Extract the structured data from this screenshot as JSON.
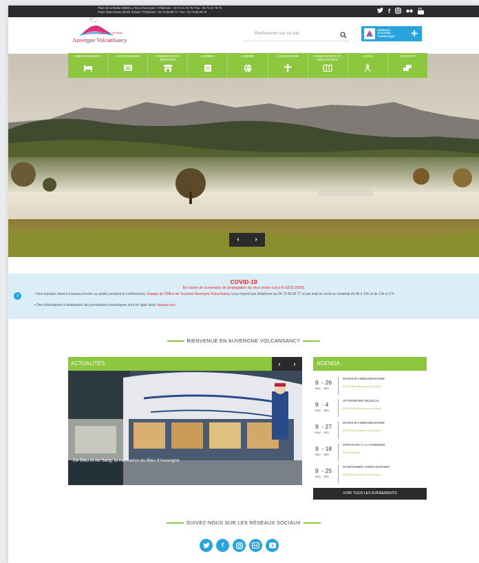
{
  "topbar": {
    "address_line1": "Place de la Mairie 63680 La Tour d'Auvergne / Téléphone : 04 73 21 79 78 / Fax : 04 73 21 79 70",
    "address_line2": "Place Notre-Dame 63210 Orcival / Téléphone : 04 73 65 89 77 / Fax : 04 73 65 89 78",
    "social_icons": [
      "twitter-icon",
      "facebook-icon",
      "instagram-icon",
      "flickr-icon",
      "youtube-icon"
    ]
  },
  "header": {
    "logo_text": "Auvergne VolcanSancy",
    "logo_sub": "Office de Tourisme",
    "search_placeholder": "Rechercher sur ce site",
    "bureau_label": "BUREAUX D'ACCUEIL TOURISTIQUE",
    "bureau_plus": "+"
  },
  "nav": [
    {
      "label": "HÉBERGEMENTS",
      "icon": "bed-icon"
    },
    {
      "label": "GASTRONOMIE",
      "icon": "cutlery-icon"
    },
    {
      "label": "COMMERCES ET SERVICES",
      "icon": "shop-icon"
    },
    {
      "label": "AGENDA",
      "icon": "calendar-icon"
    },
    {
      "label": "LOISIRS",
      "icon": "ball-icon"
    },
    {
      "label": "À DÉCOUVRIR",
      "icon": "cross-icon"
    },
    {
      "label": "RANDONNÉES ET BROCHURES",
      "icon": "map-icon"
    },
    {
      "label": "ACCÈS",
      "icon": "route-icon"
    },
    {
      "label": "CONTACT",
      "icon": "contact-icon"
    }
  ],
  "hero": {
    "prev": "‹",
    "next": "›"
  },
  "covid": {
    "title": "COVID-19",
    "subtitle": "En raison de la menace de propagation du virus (mise à jour le 02/11/2020)",
    "line1_a": "Nos bureaux étant à nouveau fermés au public pendant le confinement, ",
    "line1_link": "l'équipe de l'Office de Tourisme Auvergne VolcanSancy",
    "line1_b": " vous répond par téléphone au 04 73 65 89 77 et par mail du lundi au vendredi de 9h à 12h et de 13h à 17h.",
    "line2_a": "Des informations à destination des prestataires touristiques sont en ligne dans ",
    "line2_link": "l'espace pro."
  },
  "welcome": "BIENVENUE EN AUVERGNE VOLCANSANCY",
  "actualites": {
    "title": "ACTUALITÉS",
    "caption": "De Bleu et de Sang, la naissance du Bleu d'Auvergne.",
    "prev": "‹",
    "next": "›"
  },
  "agenda": {
    "title": "AGENDA",
    "events": [
      {
        "from": "9",
        "to": "26",
        "m1": "NOV.",
        "m2": "DÉC.",
        "name": "MARCHÉ HEBDOMADAIRE",
        "place": "63210 Saint-Bonnet-près-Orcival"
      },
      {
        "from": "9",
        "to": "4",
        "m1": "NOV.",
        "m2": "DÉC.",
        "name": "AFTERWORK MUSICAL",
        "place": "63210 Saint-Bonnet-près-Orcival"
      },
      {
        "from": "9",
        "to": "27",
        "m1": "NOV.",
        "m2": "DÉC.",
        "name": "MARCHÉ HEBDOMADAIRE",
        "place": "63950 Saint-Sauves-d'Auvergne"
      },
      {
        "from": "9",
        "to": "18",
        "m1": "NOV.",
        "m2": "DÉC.",
        "name": "INITIATION À LA VANNERIE",
        "place": "63810 Bagnols"
      },
      {
        "from": "9",
        "to": "25",
        "m1": "NOV.",
        "m2": "DÉC.",
        "name": "RANDONNÉE HORS SENTIER",
        "place": "63950 Saint-Sauves-d'Auvergne"
      }
    ],
    "all_button": "VOIR TOUS LES ÉVÉNEMENTS"
  },
  "follow": "SUIVEZ-NOUS SUR LES RÉSEAUX SOCIAUX",
  "footer_social": [
    "twitter-icon",
    "facebook-icon",
    "instagram-icon",
    "flickr-icon",
    "youtube-icon"
  ],
  "colors": {
    "green": "#8dc63f",
    "blue": "#29a3dc",
    "dark": "#2b2b2b",
    "red": "#e52420"
  }
}
